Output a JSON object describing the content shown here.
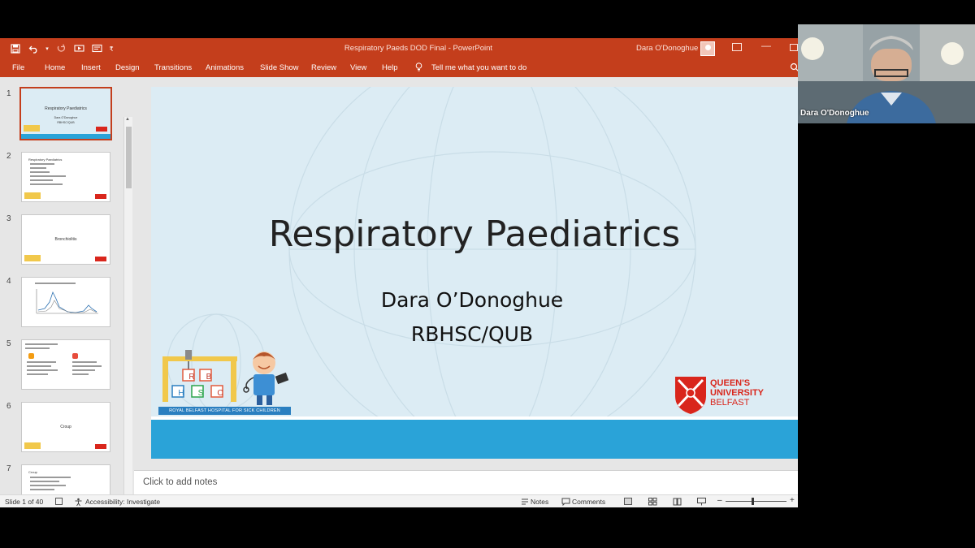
{
  "window": {
    "document_title": "Respiratory Paeds DOD Final  -  PowerPoint",
    "user_name": "Dara O'Donoghue"
  },
  "ribbon": {
    "tabs": [
      "File",
      "Home",
      "Insert",
      "Design",
      "Transitions",
      "Animations",
      "Slide Show",
      "Review",
      "View",
      "Help"
    ],
    "tell_me": "Tell me what you want to do"
  },
  "thumbnails": [
    {
      "num": "1",
      "title": "Respiratory Paediatrics",
      "sub1": "Dara O'Donoghue",
      "sub2": "RBHSC/QUB"
    },
    {
      "num": "2",
      "title": "Respiratory Paediatrics"
    },
    {
      "num": "3",
      "title": "Bronchiolitis"
    },
    {
      "num": "4",
      "title": ""
    },
    {
      "num": "5",
      "title": ""
    },
    {
      "num": "6",
      "title": "Croup"
    },
    {
      "num": "7",
      "title": "Croup"
    }
  ],
  "slide": {
    "title": "Respiratory Paediatrics",
    "author": "Dara O’Donoghue",
    "affiliation": "RBHSC/QUB",
    "rbhsc_name": "ROYAL BELFAST HOSPITAL FOR SICK CHILDREN",
    "blocks": [
      "R",
      "B",
      "H",
      "S",
      "C"
    ],
    "qub_line1": "QUEEN'S",
    "qub_line2": "UNIVERSITY",
    "qub_line3": "BELFAST"
  },
  "notes": {
    "placeholder": "Click to add notes"
  },
  "statusbar": {
    "slide_count": "Slide 1 of 40",
    "accessibility": "Accessibility: Investigate",
    "notes_label": "Notes",
    "comments_label": "Comments"
  },
  "webcam": {
    "participant_name": "Dara O'Donoghue"
  },
  "colors": {
    "accent": "#c43e1c",
    "slide_bar": "#2aa3d8",
    "qub_red": "#d9261c"
  }
}
